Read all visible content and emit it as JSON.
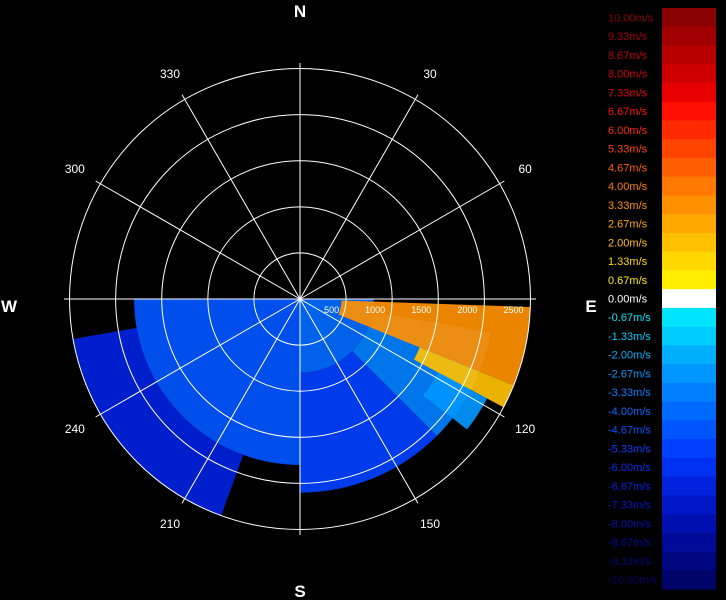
{
  "chart_data": {
    "type": "polar_sector_scan",
    "compass": {
      "north": "N",
      "south": "S",
      "east": "E",
      "west": "W"
    },
    "azimuth_labels": [
      {
        "deg": 330,
        "label": "330"
      },
      {
        "deg": 30,
        "label": "30"
      },
      {
        "deg": 300,
        "label": "300"
      },
      {
        "deg": 60,
        "label": "60"
      },
      {
        "deg": 120,
        "label": "120"
      },
      {
        "deg": 150,
        "label": "150"
      },
      {
        "deg": 210,
        "label": "210"
      },
      {
        "deg": 240,
        "label": "240"
      }
    ],
    "range_rings": [
      500,
      1000,
      1500,
      2000,
      2500
    ],
    "range_labels": [
      "500",
      "1000",
      "1500",
      "2000",
      "2500"
    ],
    "max_range": 2560,
    "scan_azimuth_range": [
      90,
      270
    ],
    "colorbar": {
      "labels": [
        "10.00m/s",
        "9.33m/s",
        "8.67m/s",
        "8.00m/s",
        "7.33m/s",
        "6.67m/s",
        "6.00m/s",
        "5.33m/s",
        "4.67m/s",
        "4.00m/s",
        "3.33m/s",
        "2.67m/s",
        "2.00m/s",
        "1.33m/s",
        "0.67m/s",
        "0.00m/s",
        "-0.67m/s",
        "-1.33m/s",
        "-2.00m/s",
        "-2.67m/s",
        "-3.33m/s",
        "-4.00m/s",
        "-4.67m/s",
        "-5.33m/s",
        "-6.00m/s",
        "-6.67m/s",
        "-7.33m/s",
        "-8.00m/s",
        "-8.67m/s",
        "-9.33m/s",
        "-10.00m/s"
      ],
      "colors": [
        "#8b0000",
        "#a00000",
        "#b80000",
        "#d00000",
        "#e80000",
        "#ff1000",
        "#ff2a00",
        "#ff4400",
        "#ff5e00",
        "#ff7800",
        "#ff9000",
        "#ffa800",
        "#ffc000",
        "#ffd800",
        "#ffee00",
        "#ffffff",
        "#00e5ff",
        "#00ccff",
        "#00b0ff",
        "#0096ff",
        "#0080ff",
        "#006aff",
        "#0055ff",
        "#0040ff",
        "#0030f0",
        "#0022dd",
        "#0018c8",
        "#0010b0",
        "#000a98",
        "#000680",
        "#000468"
      ],
      "label_colors": [
        "#8b0000",
        "#a00000",
        "#b80000",
        "#d00000",
        "#e80000",
        "#ff1000",
        "#ff2a00",
        "#ff4400",
        "#ff5e00",
        "#ff7800",
        "#ff9000",
        "#ffa800",
        "#ffc000",
        "#ffd800",
        "#ffee00",
        "#ffffff",
        "#00e5ff",
        "#00ccff",
        "#00b0ff",
        "#0096ff",
        "#0080ff",
        "#006aff",
        "#0055ff",
        "#0040ff",
        "#0030f0",
        "#0022dd",
        "#0018c8",
        "#0010b0",
        "#000a98",
        "#000680",
        "#000468"
      ]
    },
    "velocity_sectors": [
      {
        "az_from": 90,
        "az_to": 180,
        "range_from": 0,
        "range_to": 800,
        "value": -4.2
      },
      {
        "az_from": 180,
        "az_to": 270,
        "range_from": 0,
        "range_to": 1800,
        "value": -5.0
      },
      {
        "az_from": 100,
        "az_to": 135,
        "range_from": 800,
        "range_to": 2100,
        "value": -3.2
      },
      {
        "az_from": 135,
        "az_to": 180,
        "range_from": 800,
        "range_to": 2100,
        "value": -5.6
      },
      {
        "az_from": 92,
        "az_to": 112,
        "range_from": 450,
        "range_to": 2500,
        "value": 3.0
      },
      {
        "az_from": 112,
        "az_to": 118,
        "range_from": 1400,
        "range_to": 2500,
        "value": 2.2
      },
      {
        "az_from": 118,
        "az_to": 128,
        "range_from": 1700,
        "range_to": 2300,
        "value": -2.8
      },
      {
        "az_from": 200,
        "az_to": 260,
        "range_from": 1800,
        "range_to": 2500,
        "value": -6.6
      }
    ]
  }
}
